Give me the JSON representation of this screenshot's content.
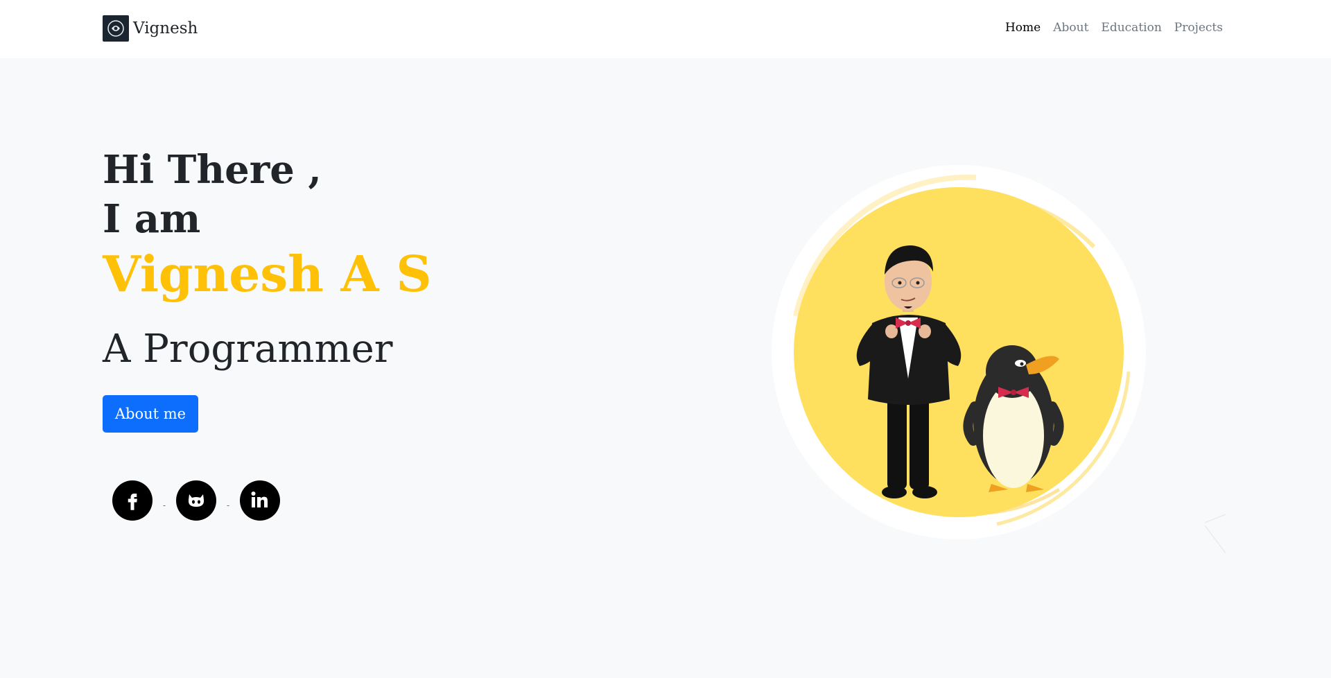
{
  "nav": {
    "brand": "Vignesh",
    "brand_logo_icon": "brain-emblem-icon",
    "items": [
      {
        "label": "Home",
        "active": true
      },
      {
        "label": "About",
        "active": false
      },
      {
        "label": "Education",
        "active": false
      },
      {
        "label": "Projects",
        "active": false
      }
    ]
  },
  "hero": {
    "greeting_line1": "Hi There ,",
    "greeting_line2": "I am",
    "name": "Vignesh A S",
    "role": "A Programmer",
    "button_label": "About me"
  },
  "socials": [
    {
      "icon": "facebook-icon"
    },
    {
      "icon": "github-icon"
    },
    {
      "icon": "linkedin-icon"
    }
  ],
  "colors": {
    "accent_yellow": "#ffc107",
    "primary_blue": "#0d6efd",
    "page_bg": "#f8f9fa",
    "avatar_circle": "#fedf5e"
  },
  "illustration": "cartoon man in tuxedo with bow tie beside penguin on yellow circle"
}
